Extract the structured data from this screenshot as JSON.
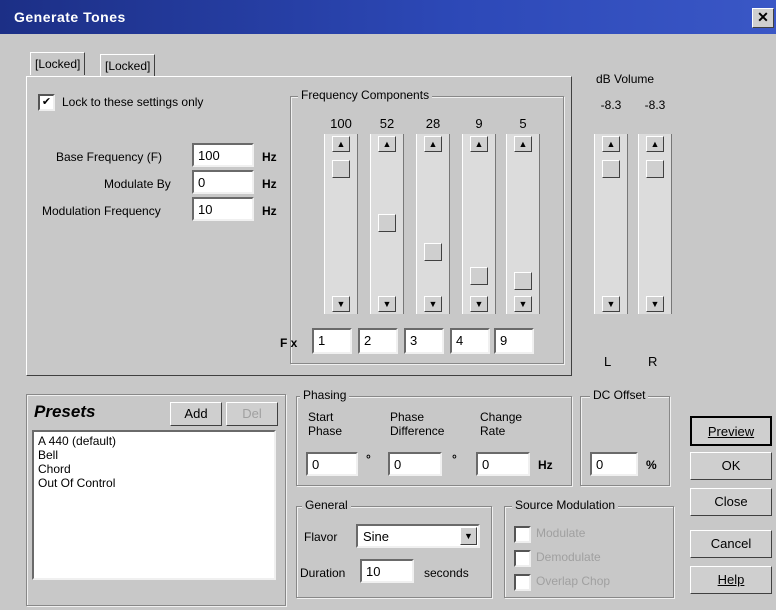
{
  "window": {
    "title": "Generate Tones",
    "close_glyph": "✕"
  },
  "tabs": [
    {
      "label": "[Locked]"
    },
    {
      "label": "[Locked]"
    }
  ],
  "lock": {
    "checked": true,
    "label": "Lock to these settings only"
  },
  "base_freq": {
    "label": "Base Frequency (F)",
    "value": "100",
    "unit": "Hz"
  },
  "modulate_by": {
    "label": "Modulate By",
    "value": "0",
    "unit": "Hz"
  },
  "mod_freq": {
    "label": "Modulation Frequency",
    "value": "10",
    "unit": "Hz"
  },
  "freq_components": {
    "title": "Frequency Components",
    "multiplier_label": "F x",
    "components": [
      {
        "level": "100",
        "multiplier": "1",
        "position": 0.05
      },
      {
        "level": "52",
        "multiplier": "2",
        "position": 0.48
      },
      {
        "level": "28",
        "multiplier": "3",
        "position": 0.72
      },
      {
        "level": "9",
        "multiplier": "4",
        "position": 0.91
      },
      {
        "level": "5",
        "multiplier": "9",
        "position": 0.95
      }
    ]
  },
  "volume": {
    "title": "dB Volume",
    "channels": [
      {
        "level": "-8.3",
        "label": "L",
        "position": 0.05
      },
      {
        "level": "-8.3",
        "label": "R",
        "position": 0.05
      }
    ]
  },
  "presets": {
    "title": "Presets",
    "add_label": "Add",
    "delete_label": "Del",
    "items": [
      "A 440 (default)",
      "Bell",
      "Chord",
      "Out Of Control"
    ]
  },
  "phasing": {
    "title": "Phasing",
    "start_label": "Start Phase",
    "diff_label": "Phase Difference",
    "rate_label": "Change Rate",
    "start_value": "0",
    "diff_value": "0",
    "rate_value": "0",
    "degree_symbol": "°",
    "rate_unit": "Hz"
  },
  "dc_offset": {
    "title": "DC Offset",
    "value": "0",
    "unit": "%"
  },
  "general": {
    "title": "General",
    "flavor_label": "Flavor",
    "flavor_value": "Sine",
    "duration_label": "Duration",
    "duration_value": "10",
    "duration_unit": "seconds"
  },
  "source_mod": {
    "title": "Source Modulation",
    "options": [
      "Modulate",
      "Demodulate",
      "Overlap Chop"
    ]
  },
  "buttons": {
    "preview": "Preview",
    "ok": "OK",
    "close": "Close",
    "cancel": "Cancel",
    "help": "Help"
  }
}
